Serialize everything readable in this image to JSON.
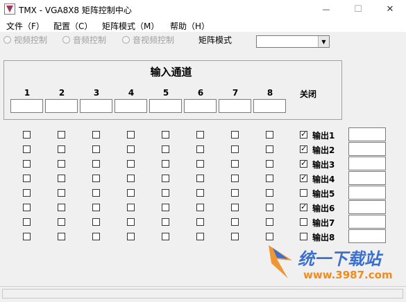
{
  "window": {
    "title": "TMX - VGA8X8 矩阵控制中心",
    "minimize_glyph": "—",
    "maximize_glyph": "☐",
    "close_glyph": "✕"
  },
  "menu": {
    "items": [
      {
        "label": "文件（F）"
      },
      {
        "label": "配置（C）"
      },
      {
        "label": "矩阵模式（M）"
      },
      {
        "label": "帮助（H）"
      }
    ]
  },
  "toolbar": {
    "radios": [
      {
        "label": "视频控制"
      },
      {
        "label": "音频控制"
      },
      {
        "label": "音视频控制"
      }
    ],
    "matrix_mode_label": "矩阵模式",
    "matrix_mode_value": "",
    "dropdown_glyph": "▼"
  },
  "input_group": {
    "title": "输入通道",
    "columns": [
      "1",
      "2",
      "3",
      "4",
      "5",
      "6",
      "7",
      "8"
    ],
    "close_label": "关闭"
  },
  "outputs": [
    {
      "label": "输出1",
      "checked": true
    },
    {
      "label": "输出2",
      "checked": true
    },
    {
      "label": "输出3",
      "checked": true
    },
    {
      "label": "输出4",
      "checked": true
    },
    {
      "label": "输出5",
      "checked": false
    },
    {
      "label": "输出6",
      "checked": true
    },
    {
      "label": "输出7",
      "checked": false
    },
    {
      "label": "输出8",
      "checked": false
    }
  ],
  "watermark": {
    "text_cn": "统一下载站",
    "text_url": "www.3987.com"
  },
  "colors": {
    "watermark_blue": "#3a6fd0",
    "watermark_orange": "#f08c1e"
  }
}
